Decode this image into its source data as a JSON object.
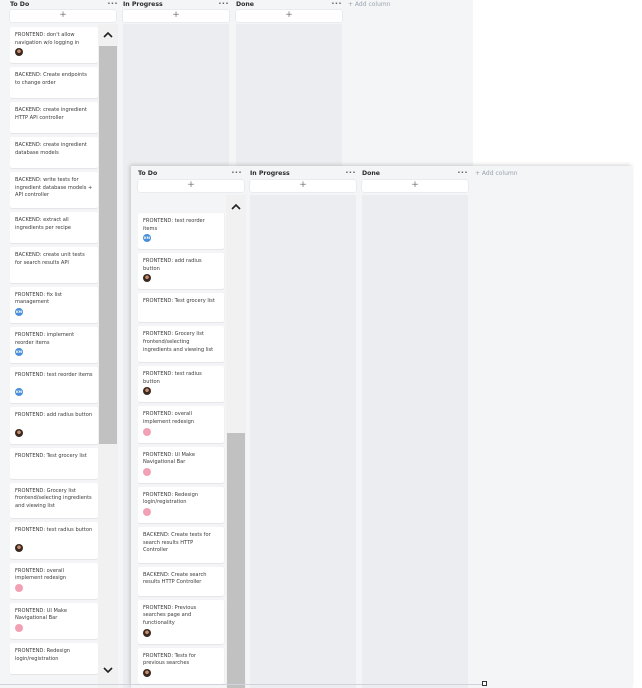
{
  "board_a": {
    "columns": [
      {
        "title": "To Do",
        "menu": "···",
        "add": "+"
      },
      {
        "title": "In Progress",
        "menu": "···",
        "add": "+"
      },
      {
        "title": "Done",
        "menu": "···",
        "add": "+"
      }
    ],
    "add_column": "+ Add column",
    "cards": [
      {
        "title": "FRONTEND: don't allow navigation w/o logging in",
        "avatar": "img"
      },
      {
        "title": "BACKEND: Create endpoints to change order",
        "avatar": ""
      },
      {
        "title": "BACKEND: create ingredient HTTP API controller",
        "avatar": ""
      },
      {
        "title": "BACKEND: create ingredient database models",
        "avatar": ""
      },
      {
        "title": "BACKEND: write tests for ingredient database models + API controller",
        "avatar": ""
      },
      {
        "title": "BACKEND: extract all ingredients per recipe",
        "avatar": ""
      },
      {
        "title": "BACKEND: create unit tests for search results API",
        "avatar": ""
      },
      {
        "title": "FRONTEND: fix list management",
        "avatar": "KM"
      },
      {
        "title": "FRONTEND: implement reorder items",
        "avatar": "KM"
      },
      {
        "title": "FRONTEND: test reorder items",
        "avatar": "KM"
      },
      {
        "title": "FRONTEND: add radius button",
        "avatar": "img"
      },
      {
        "title": "FRONTEND: Test grocery list",
        "avatar": ""
      },
      {
        "title": "FRONTEND: Grocery list frontend/selecting ingredients and viewing list",
        "avatar": ""
      },
      {
        "title": "FRONTEND: test radius button",
        "avatar": "img"
      },
      {
        "title": "FRONTEND: overall implement redesign",
        "avatar": "pink"
      },
      {
        "title": "FRONTEND: UI Make Navigational Bar",
        "avatar": "pink"
      },
      {
        "title": "FRONTEND: Redesign login/registration",
        "avatar": ""
      }
    ]
  },
  "board_b": {
    "columns": [
      {
        "title": "To Do",
        "menu": "···",
        "add": "+"
      },
      {
        "title": "In Progress",
        "menu": "···",
        "add": "+"
      },
      {
        "title": "Done",
        "menu": "···",
        "add": "+"
      }
    ],
    "add_column": "+ Add column",
    "cards": [
      {
        "title": "FRONTEND: test reorder items",
        "avatar": "KM"
      },
      {
        "title": "FRONTEND: add radius button",
        "avatar": "img"
      },
      {
        "title": "FRONTEND: Test grocery list",
        "avatar": ""
      },
      {
        "title": "FRONTEND: Grocery list frontend/selecting ingredients and viewing list",
        "avatar": ""
      },
      {
        "title": "FRONTEND: test radius button",
        "avatar": "img"
      },
      {
        "title": "FRONTEND: overall implement redesign",
        "avatar": "pink"
      },
      {
        "title": "FRONTEND: UI Make Navigational Bar",
        "avatar": "pink"
      },
      {
        "title": "FRONTEND: Redesign login/registration",
        "avatar": "pink"
      },
      {
        "title": "BACKEND: Create tests for search results HTTP Controller",
        "avatar": ""
      },
      {
        "title": "BACKEND: Create search results HTTP Controller",
        "avatar": ""
      },
      {
        "title": "FRONTEND: Previous searches page and functionality",
        "avatar": "img"
      },
      {
        "title": "FRONTEND: Tests for previous searches",
        "avatar": "img"
      }
    ]
  },
  "avatar_labels": {
    "km": "KM"
  }
}
